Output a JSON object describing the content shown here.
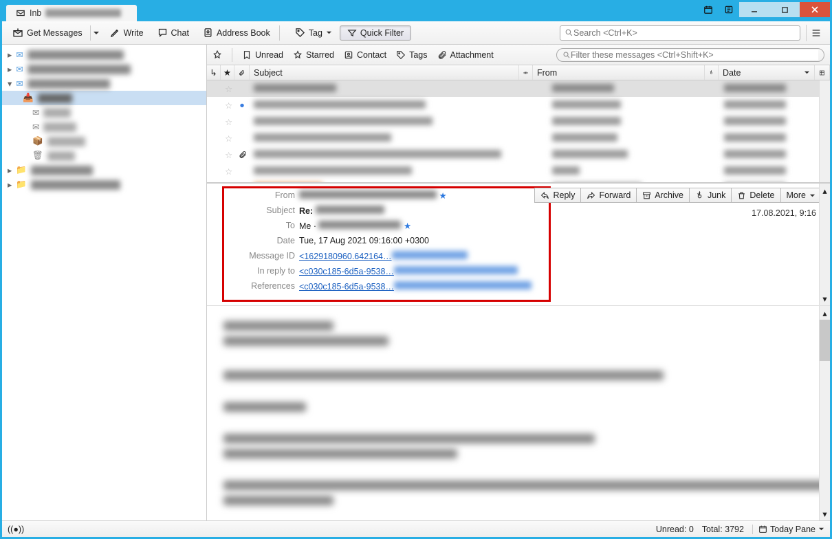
{
  "titlebar": {
    "tab_label": "Inb"
  },
  "toolbar": {
    "get_messages": "Get Messages",
    "write": "Write",
    "chat": "Chat",
    "address_book": "Address Book",
    "tag": "Tag",
    "quick_filter": "Quick Filter",
    "search_placeholder": "Search <Ctrl+K>"
  },
  "filterbar": {
    "unread": "Unread",
    "starred": "Starred",
    "contact": "Contact",
    "tags": "Tags",
    "attachment": "Attachment",
    "filter_placeholder": "Filter these messages <Ctrl+Shift+K>"
  },
  "columns": {
    "subject": "Subject",
    "from": "From",
    "date": "Date"
  },
  "header": {
    "labels": {
      "from": "From",
      "subject": "Subject",
      "to": "To",
      "date": "Date",
      "message_id": "Message ID",
      "in_reply_to": "In reply to",
      "references": "References"
    },
    "subject_prefix": "Re:",
    "to_me": "Me",
    "date_value": "Tue, 17 Aug 2021 09:16:00 +0300",
    "message_id_value": "<1629180960.642164…",
    "in_reply_to_value": "<c030c185-6d5a-9538…",
    "references_value": "<c030c185-6d5a-9538…",
    "datetime_right": "17.08.2021, 9:16"
  },
  "actions": {
    "reply": "Reply",
    "forward": "Forward",
    "archive": "Archive",
    "junk": "Junk",
    "delete": "Delete",
    "more": "More"
  },
  "status": {
    "unread": "Unread: 0",
    "total": "Total: 3792",
    "today_pane": "Today Pane"
  }
}
